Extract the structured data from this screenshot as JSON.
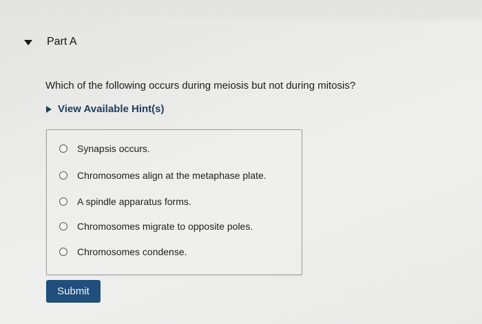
{
  "part": {
    "title": "Part A",
    "toggle_icon": "triangle-down-icon"
  },
  "question": {
    "text": "Which of the following occurs during meiosis but not during mitosis?"
  },
  "hint": {
    "label": "View Available Hint(s)",
    "icon": "triangle-right-icon"
  },
  "options": [
    {
      "label": "Synapsis occurs.",
      "selected": false
    },
    {
      "label": "Chromosomes align at the metaphase plate.",
      "selected": false
    },
    {
      "label": "A spindle apparatus forms.",
      "selected": false
    },
    {
      "label": "Chromosomes migrate to opposite poles.",
      "selected": false
    },
    {
      "label": "Chromosomes condense.",
      "selected": false
    }
  ],
  "submit": {
    "label": "Submit"
  },
  "colors": {
    "accent": "#1f4f7a",
    "hint_text": "#1d3d5c",
    "background": "#ebebea"
  }
}
